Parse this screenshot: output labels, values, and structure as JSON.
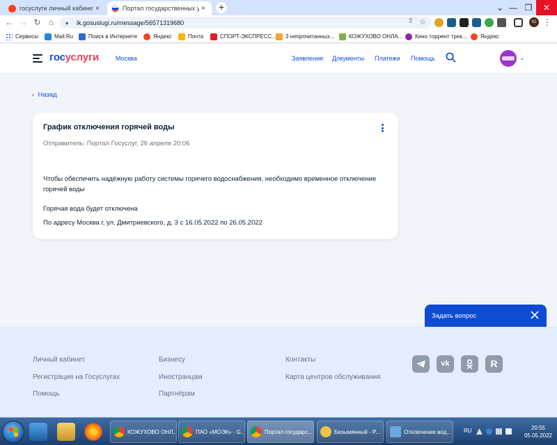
{
  "browser": {
    "tabs": [
      {
        "title": "госуслуги личный кабинет — Ян",
        "icon": "yandex-icon",
        "color": "#fc3f1d"
      },
      {
        "title": "Портал государственных услуг Ро",
        "icon": "gosuslugi-flag-icon",
        "color": "#0d4cd3",
        "active": true
      }
    ],
    "new_tab": "+",
    "close_tab": "×",
    "url": "lk.gosuslugi.ru/message/56571319680",
    "profile_initials": "Ю",
    "window_controls": {
      "minimize": "—",
      "maximize": "❐",
      "close": "✕"
    }
  },
  "bookmarks": [
    {
      "label": "Сервисы",
      "color": "#4285f4"
    },
    {
      "label": "Mail.Ru",
      "color": "#168de2"
    },
    {
      "label": "Поиск в Интернете",
      "color": "#2a6ad6"
    },
    {
      "label": "Яндекс",
      "color": "#fc3f1d"
    },
    {
      "label": "Почта",
      "color": "#f7b500"
    },
    {
      "label": "СПОРТ-ЭКСПРЕСС...",
      "color": "#e31e24"
    },
    {
      "label": "3 непрочитанных...",
      "color": "#f5a623"
    },
    {
      "label": "КОЖУХОВО ОНЛА...",
      "color": "#7cb342"
    },
    {
      "label": "Кино торрент трек...",
      "color": "#8e24aa"
    },
    {
      "label": "Яндекс",
      "color": "#fc3f1d"
    }
  ],
  "header": {
    "logo_part1": "гос",
    "logo_part2": "услуги",
    "city": "Москва",
    "nav": [
      "Заявления",
      "Документы",
      "Платежи",
      "Помощь"
    ]
  },
  "main": {
    "back_label": "Назад",
    "card": {
      "title": "График отключения горячей воды",
      "sender": "Отправитель: Портал Госуслуг, 26 апреля 20:06",
      "body1": "Чтобы обеспечить надёжную работу системы горячего водоснабжения, необходимо временное отключение горячей воды",
      "body2": "Горячая вода будет отключена",
      "body3": "По адресу Москва г, ул. Дмитриевского, д. 3 с 16.05.2022 по 26.05.2022"
    },
    "ask_button": "Задать вопрос"
  },
  "footer": {
    "col1": [
      "Личный кабинет",
      "Регистрация на Госуслугах",
      "Помощь"
    ],
    "col2": [
      "Бизнесу",
      "Иностранцам",
      "Партнёрам"
    ],
    "col3": [
      "Контакты",
      "Карта центров обслуживания"
    ],
    "social": [
      "telegram-icon",
      "vk-icon",
      "odnoklassniki-icon",
      "rutube-icon"
    ],
    "vk_glyph": "vk",
    "rutube_glyph": "R"
  },
  "taskbar": {
    "items": [
      {
        "label": "КОЖУХОВО ОНЛ...",
        "color": "#e8453c"
      },
      {
        "label": "ПАО «МОЭК» - G...",
        "color": "#e8453c"
      },
      {
        "label": "Портал государс...",
        "color": "#e8453c",
        "active": true
      },
      {
        "label": "Безымянный - P...",
        "color": "#f0c541"
      },
      {
        "label": "Отключение вод...",
        "color": "#6aa7e0"
      }
    ],
    "lang": "RU",
    "time": "20:55",
    "date": "05.05.2022"
  }
}
